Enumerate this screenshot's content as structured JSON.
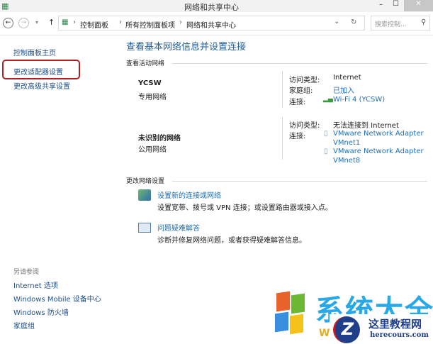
{
  "window": {
    "title": "网络和共享中心",
    "min": "–",
    "max": "☐",
    "close": "✕"
  },
  "address": {
    "back": "←",
    "forward": "→",
    "dropdown": "▾",
    "up": "↑",
    "crumbs": [
      "控制面板",
      "所有控制面板项",
      "网络和共享中心"
    ],
    "sep": "›",
    "refresh": "↻",
    "expand": "⌄",
    "search_placeholder": "搜索控制...",
    "search_icon": "⚲"
  },
  "sidebar": {
    "items": [
      "控制面板主页",
      "更改适配器设置",
      "更改高级共享设置"
    ],
    "see_also_title": "另请参阅",
    "see_also": [
      "Internet 选项",
      "Windows Mobile 设备中心",
      "Windows 防火墙",
      "家庭组"
    ]
  },
  "main": {
    "heading": "查看基本网络信息并设置连接",
    "active_title": "查看活动网络",
    "net1": {
      "name": "YCSW",
      "type": "专用网络",
      "l1": "访问类型:",
      "v1": "Internet",
      "l2": "家庭组:",
      "v2": "已加入",
      "l3": "连接:",
      "v3": "Wi-Fi 4 (YCSW)"
    },
    "net2": {
      "name": "未识别的网络",
      "type": "公用网络",
      "l1": "访问类型:",
      "v1": "无法连接到 Internet",
      "l2": "连接:",
      "a1": "VMware Network Adapter",
      "a1b": "VMnet1",
      "a2": "VMware Network Adapter",
      "a2b": "VMnet8"
    },
    "change_title": "更改网络设置",
    "task1": {
      "link": "设置新的连接或网络",
      "desc": "设置宽带、拨号或 VPN 连接；或设置路由器或接入点。"
    },
    "task2": {
      "link": "问题疑难解答",
      "desc": "诊断并修复网络问题，或者获得疑难解答信息。"
    }
  },
  "watermark": {
    "t1": "系统大全",
    "t2": "W",
    "t3": "这里教程网",
    "t4": "herecours.com"
  },
  "accent": "#1f6fb5",
  "highlight": "#b02020"
}
